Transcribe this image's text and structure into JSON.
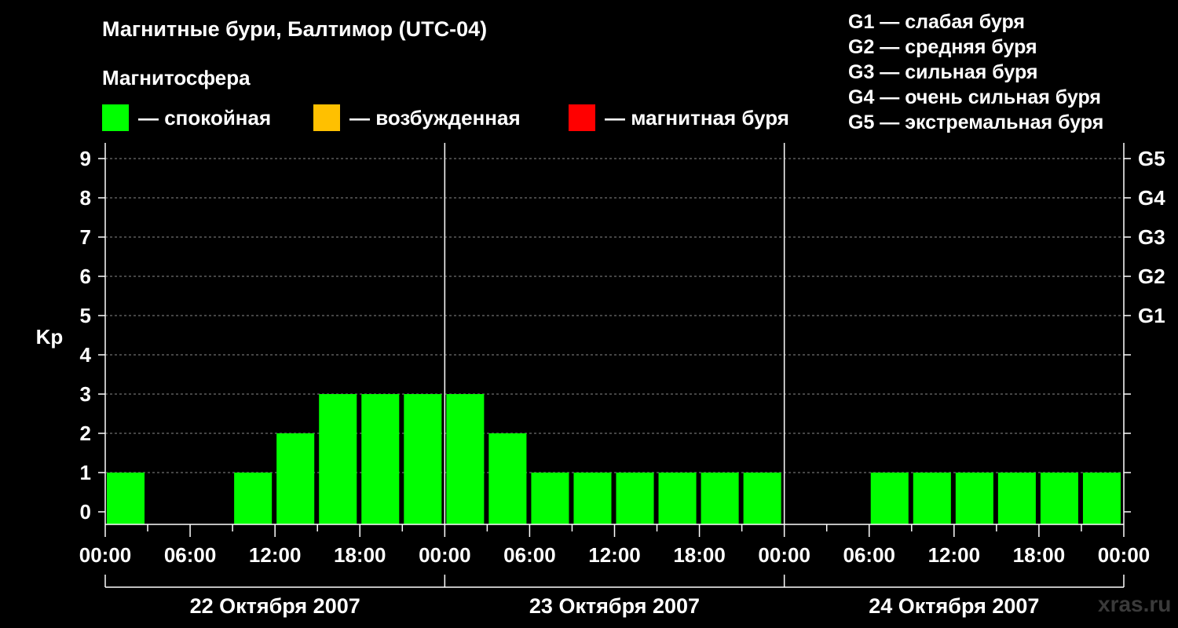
{
  "title": "Магнитные бури, Балтимор (UTC-04)",
  "subtitle": "Магнитосфера",
  "legend": [
    {
      "color": "#00ff00",
      "label": "— спокойная"
    },
    {
      "color": "#ffc000",
      "label": "— возбужденная"
    },
    {
      "color": "#ff0000",
      "label": "— магнитная буря"
    }
  ],
  "g_levels": [
    "G1 — слабая буря",
    "G2 — средняя буря",
    "G3 — сильная буря",
    "G4 — очень сильная буря",
    "G5 — экстремальная буря"
  ],
  "watermark": "xras.ru",
  "chart_data": {
    "type": "bar",
    "ylabel": "Kp",
    "ylim": [
      0,
      9
    ],
    "yticks": [
      "0",
      "1",
      "2",
      "3",
      "4",
      "5",
      "6",
      "7",
      "8",
      "9"
    ],
    "right_axis_labels": [
      {
        "kp": 5,
        "label": "G1"
      },
      {
        "kp": 6,
        "label": "G2"
      },
      {
        "kp": 7,
        "label": "G3"
      },
      {
        "kp": 8,
        "label": "G4"
      },
      {
        "kp": 9,
        "label": "G5"
      }
    ],
    "grid": true,
    "x_tick_labels": [
      "00:00",
      "06:00",
      "12:00",
      "18:00",
      "00:00",
      "06:00",
      "12:00",
      "18:00",
      "00:00",
      "06:00",
      "12:00",
      "18:00",
      "00:00"
    ],
    "days": [
      "22 Октября 2007",
      "23 Октября 2007",
      "24 Октября 2007"
    ],
    "interval_hours": 3,
    "values": [
      1,
      0,
      0,
      1,
      2,
      3,
      3,
      3,
      3,
      2,
      1,
      1,
      1,
      1,
      1,
      1,
      0,
      0,
      1,
      1,
      1,
      1,
      1,
      1
    ],
    "bar_color": "#00ff00"
  }
}
